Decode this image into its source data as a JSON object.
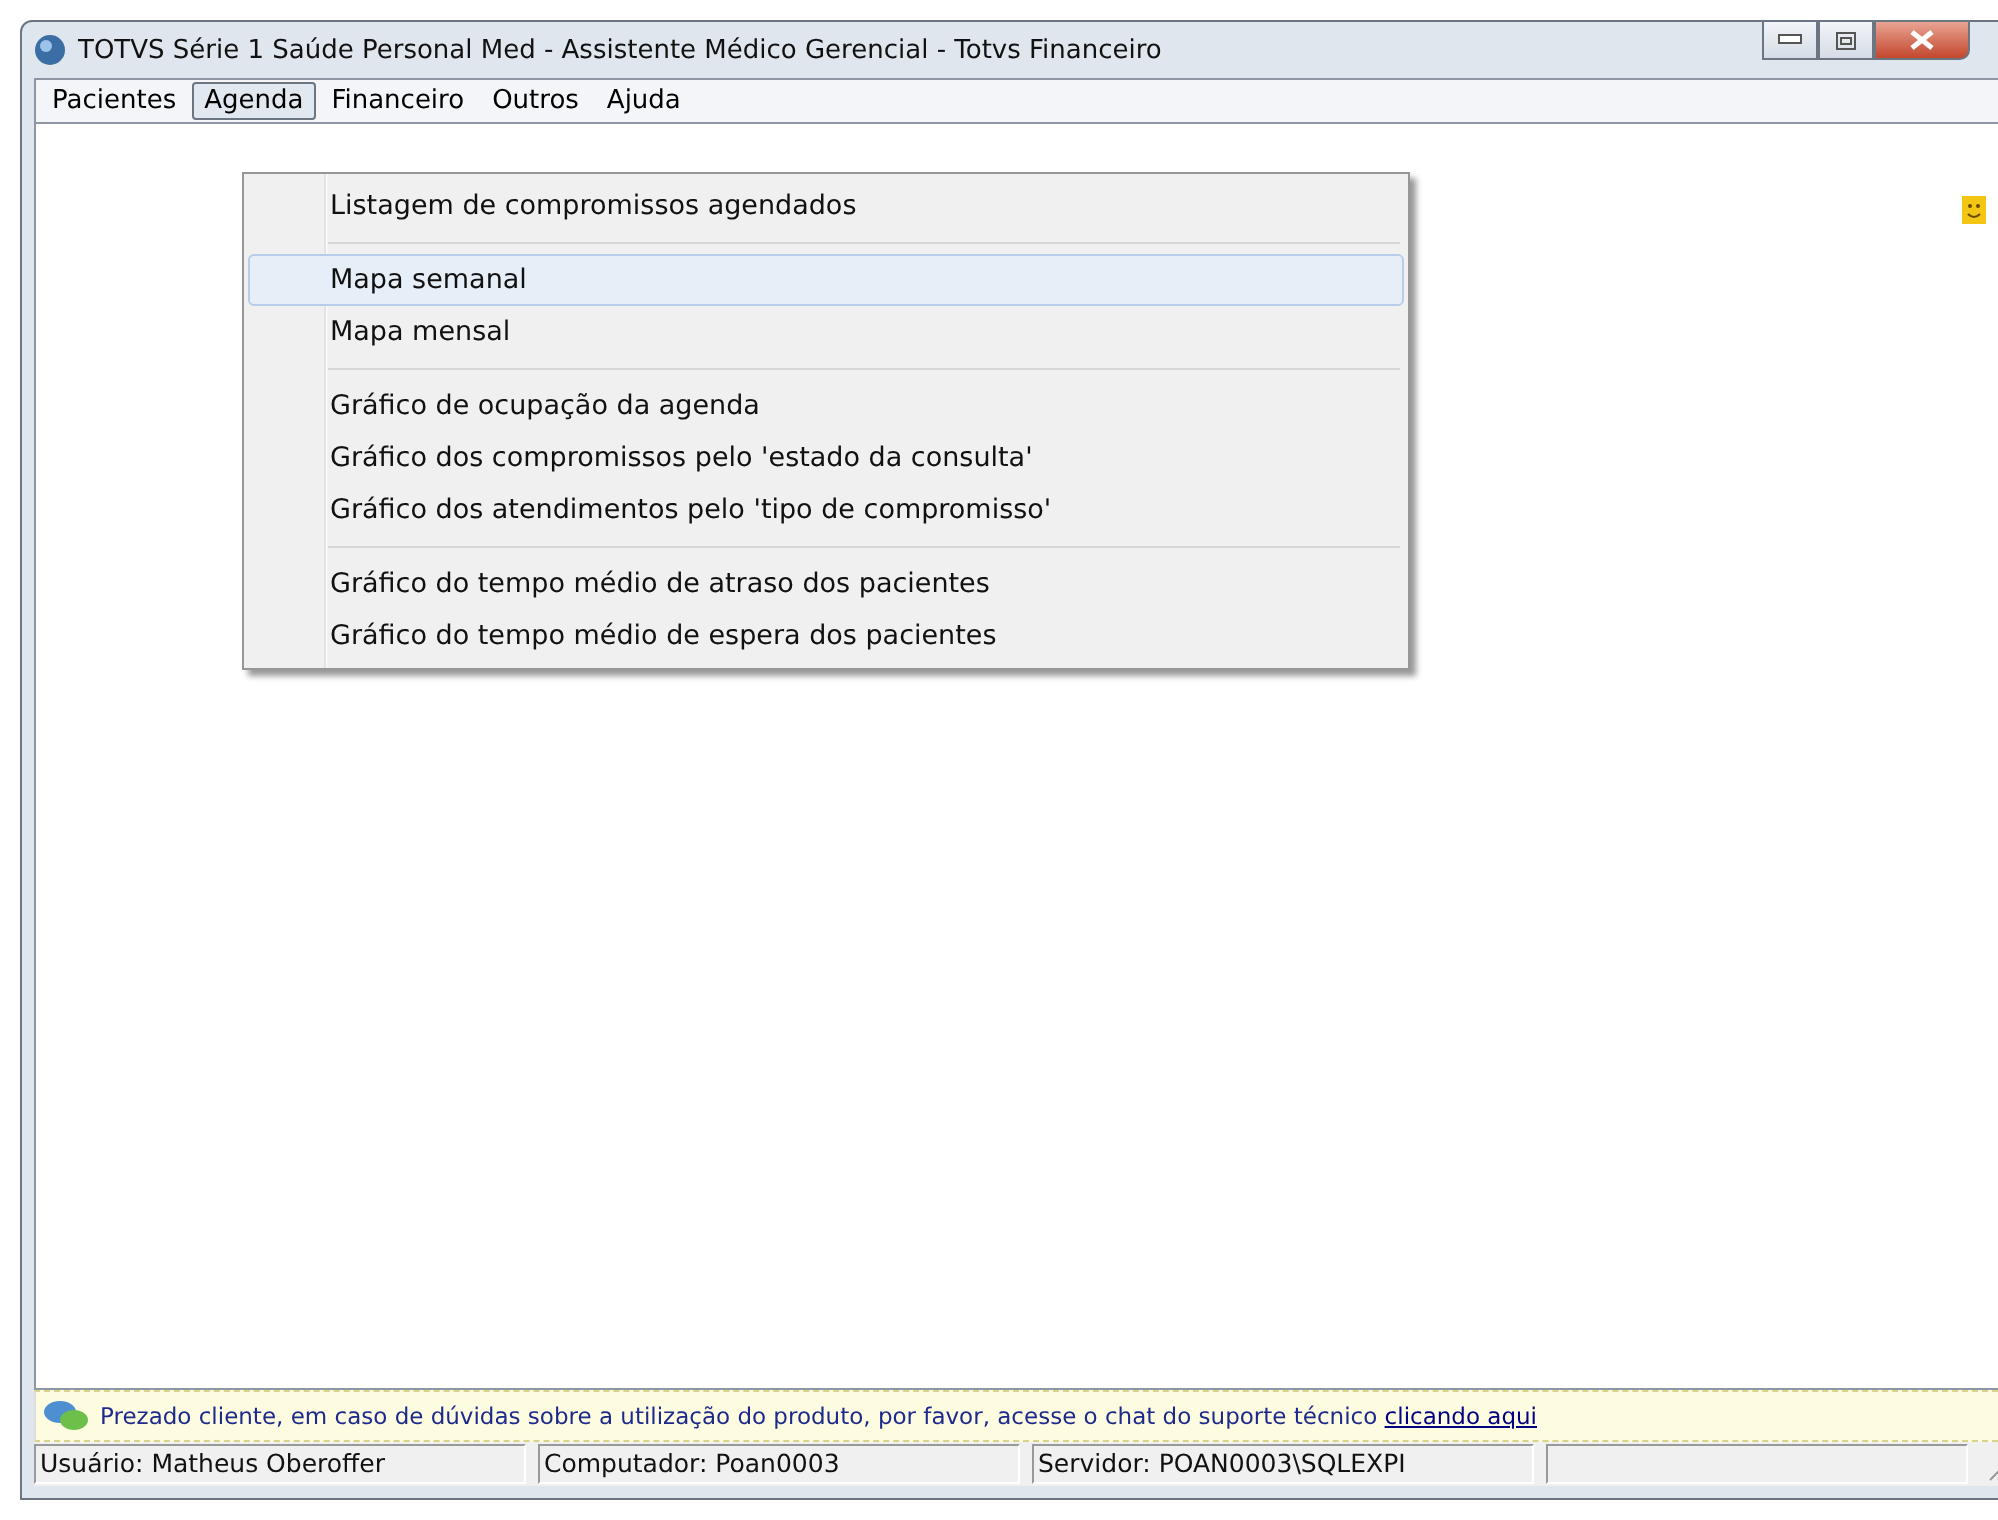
{
  "window": {
    "title": "TOTVS Série 1 Saúde Personal Med - Assistente Médico Gerencial - Totvs  Financeiro"
  },
  "menubar": [
    {
      "label": "Pacientes",
      "selected": false
    },
    {
      "label": "Agenda",
      "selected": true
    },
    {
      "label": "Financeiro",
      "selected": false
    },
    {
      "label": "Outros",
      "selected": false
    },
    {
      "label": "Ajuda",
      "selected": false
    }
  ],
  "dropdown": [
    {
      "kind": "item",
      "label": "Listagem de compromissos agendados",
      "selected": false
    },
    {
      "kind": "separator"
    },
    {
      "kind": "item",
      "label": "Mapa semanal",
      "selected": true
    },
    {
      "kind": "item",
      "label": "Mapa mensal",
      "selected": false
    },
    {
      "kind": "separator"
    },
    {
      "kind": "item",
      "label": "Gráfico de ocupação da agenda",
      "selected": false
    },
    {
      "kind": "item",
      "label": "Gráfico dos compromissos pelo 'estado da consulta'",
      "selected": false
    },
    {
      "kind": "item",
      "label": "Gráfico dos atendimentos pelo 'tipo de compromisso'",
      "selected": false
    },
    {
      "kind": "separator"
    },
    {
      "kind": "item",
      "label": "Gráfico do tempo médio de atraso dos pacientes",
      "selected": false
    },
    {
      "kind": "item",
      "label": "Gráfico do tempo médio de espera dos pacientes",
      "selected": false
    }
  ],
  "notice": {
    "text": "Prezado cliente, em caso de dúvidas sobre a utilização do produto, por favor, acesse o chat do suporte técnico",
    "link": "clicando aqui"
  },
  "status_bar": [
    "Usuário: Matheus Oberoffer",
    "Computador: Poan0003",
    "Servidor: POAN0003\\SQLEXPI"
  ]
}
